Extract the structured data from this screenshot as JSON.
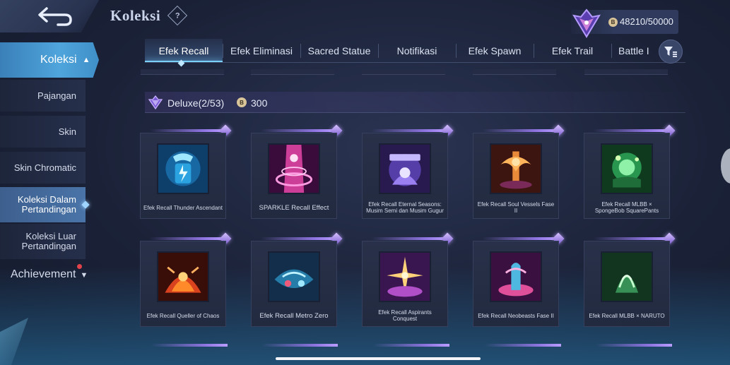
{
  "header": {
    "title": "Koleksi",
    "help_symbol": "?",
    "currency_symbol": "B",
    "currency_value": "48210/50000"
  },
  "sidebar": {
    "main": {
      "label": "Koleksi",
      "expanded": true
    },
    "items": [
      {
        "label": "Pajangan",
        "active": false
      },
      {
        "label": "Skin",
        "active": false
      },
      {
        "label": "Skin Chromatic",
        "active": false
      },
      {
        "label": "Koleksi Dalam Pertandingan",
        "active": true
      },
      {
        "label": "Koleksi Luar Pertandingan",
        "active": false
      }
    ],
    "achievement": "Achievement"
  },
  "tabs": [
    {
      "label": "Efek Recall",
      "active": true
    },
    {
      "label": "Efek Eliminasi",
      "active": false
    },
    {
      "label": "Sacred Statue",
      "active": false
    },
    {
      "label": "Notifikasi",
      "active": false
    },
    {
      "label": "Efek Spawn",
      "active": false
    },
    {
      "label": "Efek Trail",
      "active": false
    },
    {
      "label": "Battle I",
      "active": false
    }
  ],
  "section": {
    "label": "Deluxe(2/53)",
    "price_symbol": "B",
    "price": "300"
  },
  "cards": [
    {
      "name": "Efek Recall Thunder Ascendant",
      "theme": "thunder",
      "large": false
    },
    {
      "name": "SPARKLE Recall Effect",
      "theme": "sparkle",
      "large": true
    },
    {
      "name": "Efek Recall Eternal Seasons: Musim Semi dan Musim Gugur",
      "theme": "eternal",
      "large": false
    },
    {
      "name": "Efek Recall Soul Vessels Fase II",
      "theme": "soul",
      "large": false
    },
    {
      "name": "Efek Recall MLBB × SpongeBob SquarePants",
      "theme": "sponge",
      "large": false
    },
    {
      "name": "Efek Recall Queller of Chaos",
      "theme": "chaos",
      "large": false
    },
    {
      "name": "Efek Recall Metro Zero",
      "theme": "metro",
      "large": true
    },
    {
      "name": "Efek Recall Aspirants Conquest",
      "theme": "aspirants",
      "large": false
    },
    {
      "name": "Efek Recall Neobeasts Fase II",
      "theme": "neobeasts",
      "large": false
    },
    {
      "name": "Efek Recall MLBB × NARUTO",
      "theme": "naruto",
      "large": false
    }
  ],
  "colors": {
    "accent": "#7ad0ff",
    "deluxe": "#8e74e0",
    "sidebar_active": "#4fa5dc",
    "notification": "#e2424a"
  }
}
